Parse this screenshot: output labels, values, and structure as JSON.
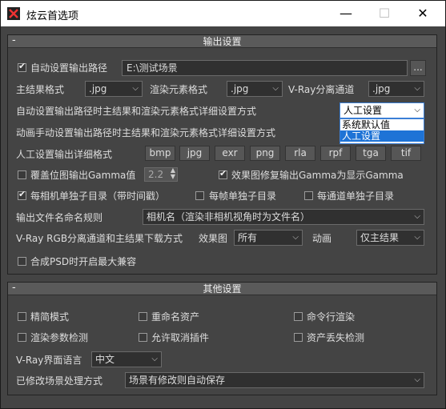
{
  "window": {
    "title": "炫云首选项",
    "minimize": "—",
    "maximize": "☐",
    "close": "✕"
  },
  "output": {
    "header": "输出设置",
    "collapse": "-",
    "auto_path_label": "自动设置输出路径",
    "auto_path_value": "E:\\测试场景",
    "browse": "...",
    "main_format_label": "主结果格式",
    "main_format": ".jpg",
    "render_elem_label": "渲染元素格式",
    "render_elem_format": ".jpg",
    "vray_sep_label": "V-Ray分离通道",
    "vray_sep_format": ".jpg",
    "detail_mode_label": "自动设置输出路径时主结果和渲染元素格式详细设置方式",
    "detail_mode_value": "人工设置",
    "detail_mode_options": [
      "系统默认值",
      "人工设置"
    ],
    "anim_label": "动画手动设置输出路径时主结果和渲染元素格式详细设置方式",
    "manual_detail_label": "人工设置输出详细格式",
    "formats": [
      "bmp",
      "jpg",
      "exr",
      "png",
      "rla",
      "rpf",
      "tga",
      "tif"
    ],
    "override_gamma_label": "覆盖位图输出Gamma值",
    "gamma_value": "2.2",
    "fix_gamma_label": "效果图修复输出Gamma为显示Gamma",
    "per_camera_label": "每相机单独子目录（带时间戳）",
    "per_frame_label": "每帧单独子目录",
    "per_channel_label": "每通道单独子目录",
    "naming_label": "输出文件名命名规则",
    "naming_value": "相机名（渲染非相机视角时为文件名）",
    "download_label": "V-Ray RGB分离通道和主结果下载方式",
    "effect_label": "效果图",
    "effect_value": "所有",
    "anim_short_label": "动画",
    "anim_value": "仅主结果",
    "psd_label": "合成PSD时开启最大兼容"
  },
  "other": {
    "header": "其他设置",
    "collapse": "-",
    "lite_label": "精简模式",
    "rename_label": "重命名资产",
    "cmd_label": "命令行渲染",
    "render_check_label": "渲染参数检测",
    "cancel_plugin_label": "允许取消插件",
    "missing_label": "资产丢失检测",
    "lang_label": "V-Ray界面语言",
    "lang_value": "中文",
    "scene_label": "已修改场景处理方式",
    "scene_value": "场景有修改则自动保存"
  },
  "colors": {
    "accent": "#1e73d6",
    "panel": "#444444"
  }
}
